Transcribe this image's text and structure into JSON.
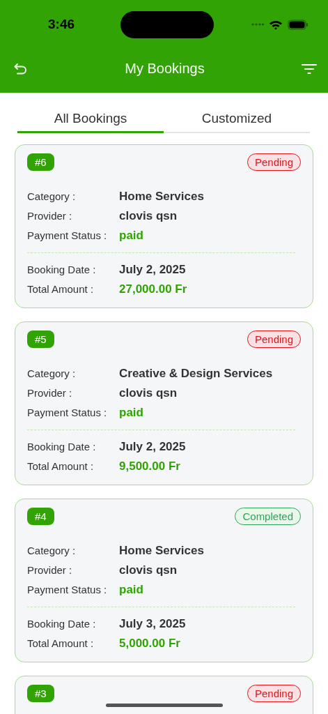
{
  "status_bar": {
    "time": "3:46"
  },
  "header": {
    "title": "My Bookings"
  },
  "tabs": [
    {
      "label": "All Bookings",
      "selected": true
    },
    {
      "label": "Customized",
      "selected": false
    }
  ],
  "bookings": [
    {
      "number": "#6",
      "status": "Pending",
      "kind": "pending",
      "fields": [
        {
          "label": "Category :",
          "value": "Home Services"
        },
        {
          "label": "Provider :",
          "value": "clovis qsn"
        },
        {
          "label": "Payment Status :",
          "value": "paid",
          "kind": "status"
        }
      ],
      "totals": [
        {
          "label": "Booking Date :",
          "value": "July 2, 2025"
        },
        {
          "label": "Total Amount :",
          "value": "27,000.00 Fr",
          "kind": "amount"
        }
      ]
    },
    {
      "number": "#5",
      "status": "Pending",
      "kind": "pending",
      "fields": [
        {
          "label": "Category :",
          "value": "Creative & Design Services"
        },
        {
          "label": "Provider :",
          "value": "clovis qsn"
        },
        {
          "label": "Payment Status :",
          "value": "paid",
          "kind": "status"
        }
      ],
      "totals": [
        {
          "label": "Booking Date :",
          "value": "July 2, 2025"
        },
        {
          "label": "Total Amount :",
          "value": "9,500.00 Fr",
          "kind": "amount"
        }
      ]
    },
    {
      "number": "#4",
      "status": "Completed",
      "kind": "completed",
      "fields": [
        {
          "label": "Category :",
          "value": "Home Services"
        },
        {
          "label": "Provider :",
          "value": "clovis qsn"
        },
        {
          "label": "Payment Status :",
          "value": "paid",
          "kind": "status"
        }
      ],
      "totals": [
        {
          "label": "Booking Date :",
          "value": "July 3, 2025"
        },
        {
          "label": "Total Amount :",
          "value": "5,000.00 Fr",
          "kind": "amount"
        }
      ]
    },
    {
      "number": "#3",
      "status": "Pending",
      "kind": "pending"
    }
  ]
}
